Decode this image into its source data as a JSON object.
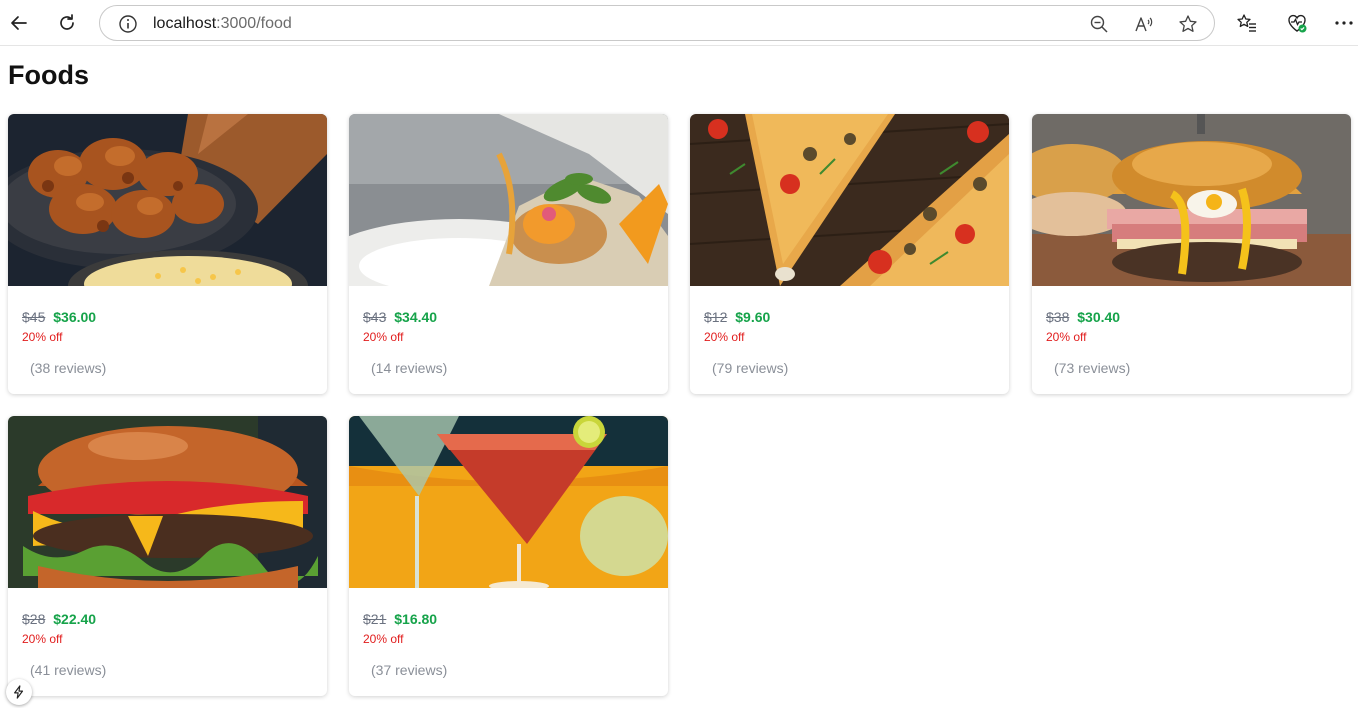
{
  "browser": {
    "url_host": "localhost",
    "url_path": ":3000/food",
    "icons": [
      "back-arrow-icon",
      "refresh-icon",
      "info-icon",
      "zoom-out-icon",
      "read-aloud-icon",
      "favorite-star-icon",
      "favorites-list-icon",
      "browser-essentials-icon",
      "more-options-icon"
    ]
  },
  "page": {
    "title": "Foods"
  },
  "foods": [
    {
      "image": "fried-chicken",
      "original_price": "$45",
      "sale_price": "$36.00",
      "discount": "20% off",
      "reviews": "(38 reviews)"
    },
    {
      "image": "gourmet-plate",
      "original_price": "$43",
      "sale_price": "$34.40",
      "discount": "20% off",
      "reviews": "(14 reviews)"
    },
    {
      "image": "pizza",
      "original_price": "$12",
      "sale_price": "$9.60",
      "discount": "20% off",
      "reviews": "(79 reviews)"
    },
    {
      "image": "ham-egg-burger",
      "original_price": "$38",
      "sale_price": "$30.40",
      "discount": "20% off",
      "reviews": "(73 reviews)"
    },
    {
      "image": "cheeseburger",
      "original_price": "$28",
      "sale_price": "$22.40",
      "discount": "20% off",
      "reviews": "(41 reviews)"
    },
    {
      "image": "cocktail",
      "original_price": "$21",
      "sale_price": "$16.80",
      "discount": "20% off",
      "reviews": "(37 reviews)"
    }
  ],
  "colors": {
    "sale_price": "#16a34a",
    "discount": "#e11d1d",
    "original_price": "#6b7280",
    "reviews": "#8a8f98"
  }
}
